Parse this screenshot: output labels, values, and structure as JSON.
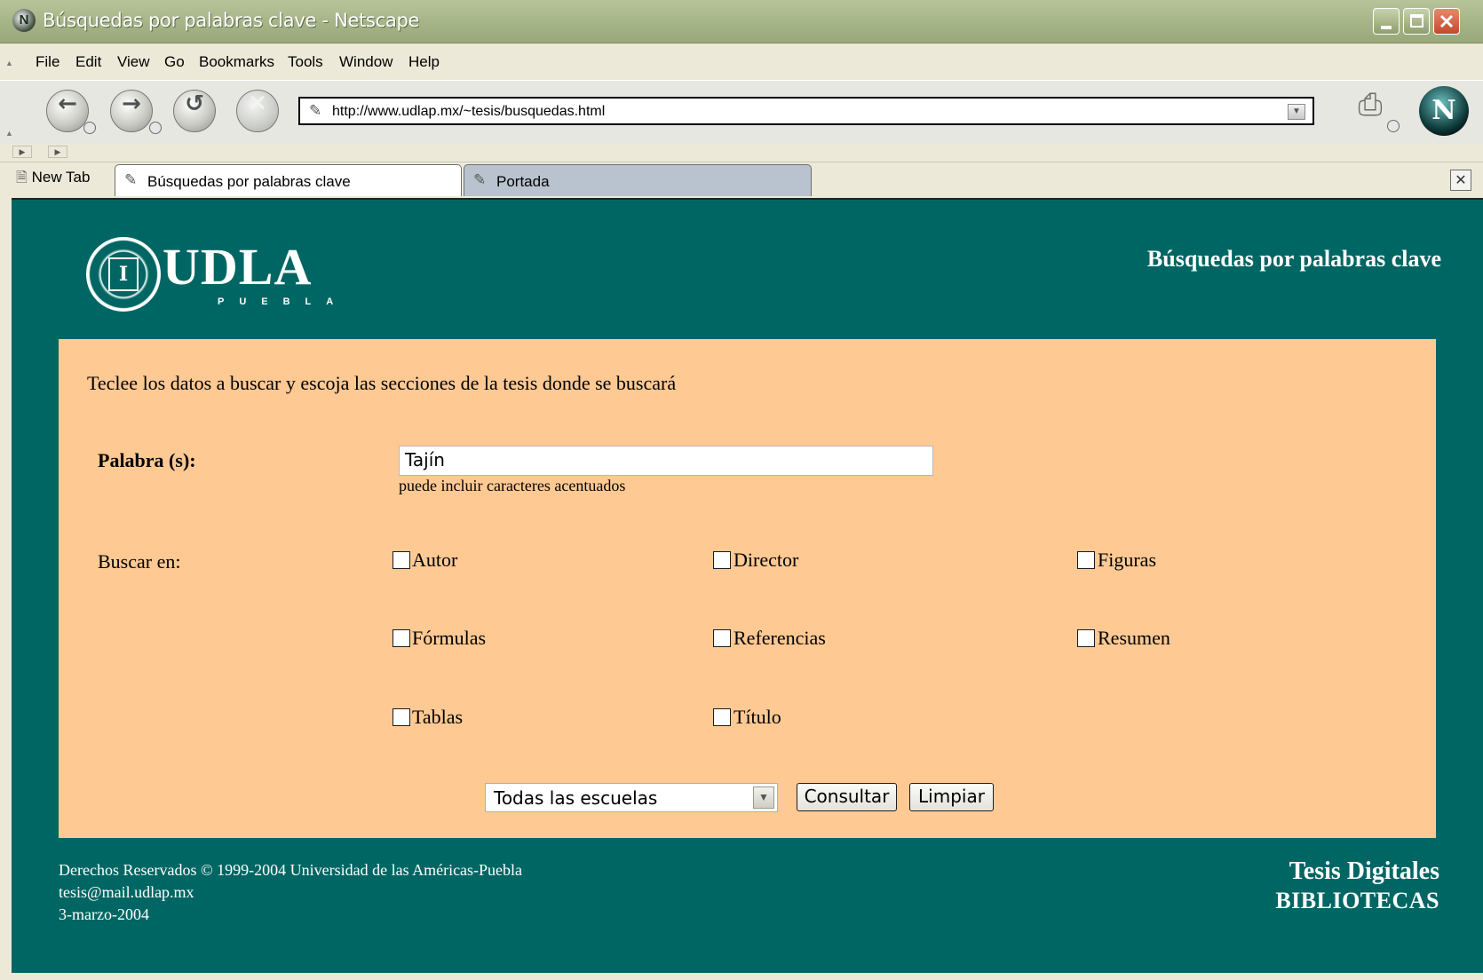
{
  "window": {
    "title": "Búsquedas por palabras clave - Netscape",
    "app_icon": "netscape-icon",
    "buttons": [
      "minimize",
      "maximize",
      "close"
    ]
  },
  "menubar": {
    "items": [
      "File",
      "Edit",
      "View",
      "Go",
      "Bookmarks",
      "Tools",
      "Window",
      "Help"
    ]
  },
  "navbar": {
    "back": "back-arrow-icon",
    "forward": "forward-arrow-icon",
    "reload": "reload-icon",
    "stop": "stop-icon",
    "url": "http://www.udlap.mx/~tesis/busquedas.html"
  },
  "tabs": {
    "new_tab": "New Tab",
    "items": [
      {
        "label": "Búsquedas por palabras clave",
        "active": true
      },
      {
        "label": "Portada",
        "active": false
      }
    ]
  },
  "page": {
    "logo_text": "UDLA",
    "logo_subtext": "PUEBLA",
    "heading": "Búsquedas por palabras clave",
    "intro": "Teclee los datos a buscar y escoja las secciones de la tesis donde se buscará",
    "palabra_label": "Palabra (s):",
    "palabra_value": "Tajín",
    "hint": "puede incluir caracteres acentuados",
    "buscar_label": "Buscar en:",
    "checkboxes": [
      {
        "label": "Autor",
        "checked": false
      },
      {
        "label": "Director",
        "checked": false
      },
      {
        "label": "Figuras",
        "checked": false
      },
      {
        "label": "Fórmulas",
        "checked": false
      },
      {
        "label": "Referencias",
        "checked": false
      },
      {
        "label": "Resumen",
        "checked": false
      },
      {
        "label": "Tablas",
        "checked": false
      },
      {
        "label": "Título",
        "checked": false
      }
    ],
    "school_select": "Todas las escuelas",
    "consultar": "Consultar",
    "limpiar": "Limpiar"
  },
  "footer": {
    "copyright": "Derechos Reservados © 1999-2004 Universidad de las Américas-Puebla",
    "email": "tesis@mail.udlap.mx",
    "date": "3-marzo-2004",
    "brand_line1": "Tesis Digitales",
    "brand_line2": "BIBLIOTECAS"
  },
  "colors": {
    "page_bg": "#006663",
    "panel_bg": "#ffc993",
    "titlebar": "#a5b487"
  }
}
